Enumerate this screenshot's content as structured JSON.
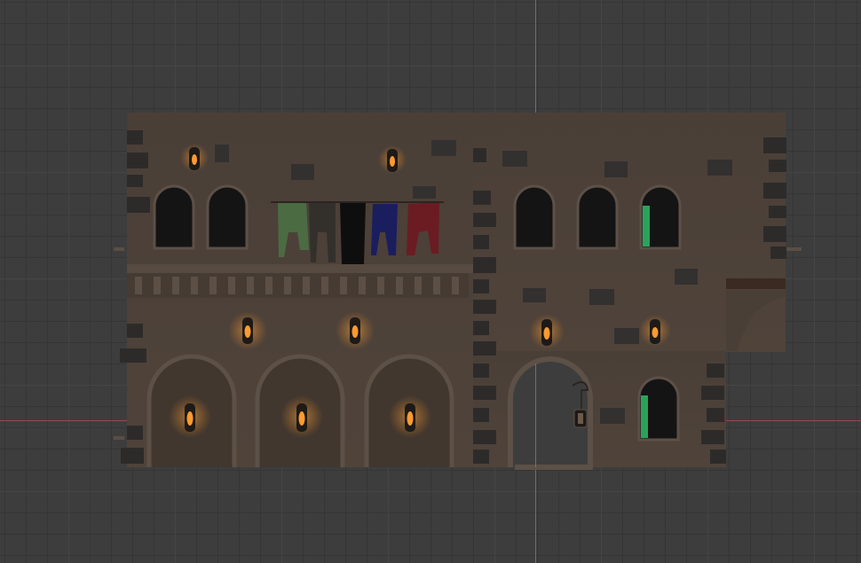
{
  "viewport": {
    "view": "front-orthographic",
    "grid_visible": true,
    "axes": [
      "z-axis",
      "x-axis"
    ]
  },
  "colors": {
    "background": "#3d3d3d",
    "wall": "#4b4038",
    "wall_dark": "#3c332c",
    "stone": "#2c2a29",
    "lamp_glow": "#ff9a2e",
    "axis_x": "#b54a52",
    "axis_z": "#4f87c4"
  },
  "scene": {
    "object": "medieval-building-facade",
    "banners": [
      "green",
      "dark-gray",
      "black",
      "blue",
      "red"
    ],
    "lit_window": "green"
  }
}
